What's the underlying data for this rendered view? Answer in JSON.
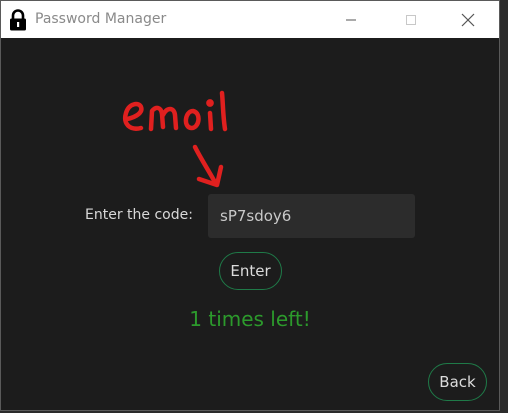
{
  "window": {
    "title": "Password Manager",
    "icon": "lock-icon"
  },
  "annotation": {
    "text": "email",
    "color": "#e0201f"
  },
  "form": {
    "code_label": "Enter the code:",
    "code_value": "sP7sdoy6",
    "enter_label": "Enter",
    "status_text": "1 times left!",
    "status_color": "#2c9a2c"
  },
  "footer": {
    "back_label": "Back"
  },
  "colors": {
    "background": "#1c1c1c",
    "button_border": "#1f7a48",
    "input_background": "#2c2c2c"
  }
}
